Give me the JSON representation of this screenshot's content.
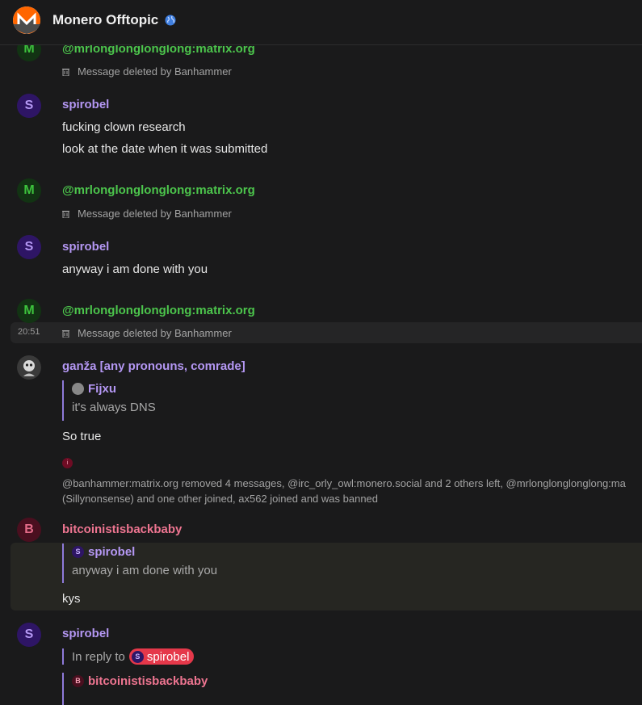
{
  "header": {
    "title": "Monero Offtopic",
    "room_icon": "monero-logo",
    "globe_icon": "globe-icon"
  },
  "messages": [
    {
      "sender": "@mrlonglonglonglong:matrix.org",
      "avatar": "M",
      "deleted": "Message deleted by Banhammer"
    },
    {
      "sender": "spirobel",
      "avatar": "S",
      "lines": [
        "fucking clown research",
        "look at the date when it was submitted"
      ]
    },
    {
      "sender": "@mrlonglonglonglong:matrix.org",
      "avatar": "M",
      "deleted": "Message deleted by Banhammer"
    },
    {
      "sender": "spirobel",
      "avatar": "S",
      "lines": [
        "anyway i am done with you"
      ]
    },
    {
      "sender": "@mrlonglonglonglong:matrix.org",
      "avatar": "M",
      "deleted": "Message deleted by Banhammer",
      "timestamp": "20:51"
    },
    {
      "sender": "ganža [any pronouns, comrade]",
      "quote_sender": "Fijxu",
      "quote_text": "it's always DNS",
      "body": "So true"
    },
    {
      "state_icon": "i",
      "state_line1": "@banhammer:matrix.org removed 4 messages, @irc_orly_owl:monero.social and 2 others left, @mrlonglonglonglong:ma",
      "state_line2": "(Sillynonsense) and one other joined, ax562 joined and was banned"
    },
    {
      "sender": "bitcoinistisbackbaby",
      "avatar": "B",
      "quote_sender": "spirobel",
      "quote_avatar": "S",
      "quote_text": "anyway i am done with you",
      "body": "kys"
    },
    {
      "sender": "spirobel",
      "avatar": "S",
      "reply_prefix": "In reply to",
      "reply_pill": "spirobel",
      "reply_pill_avatar": "S",
      "quote_sender": "bitcoinistisbackbaby",
      "quote_avatar": "B"
    }
  ]
}
